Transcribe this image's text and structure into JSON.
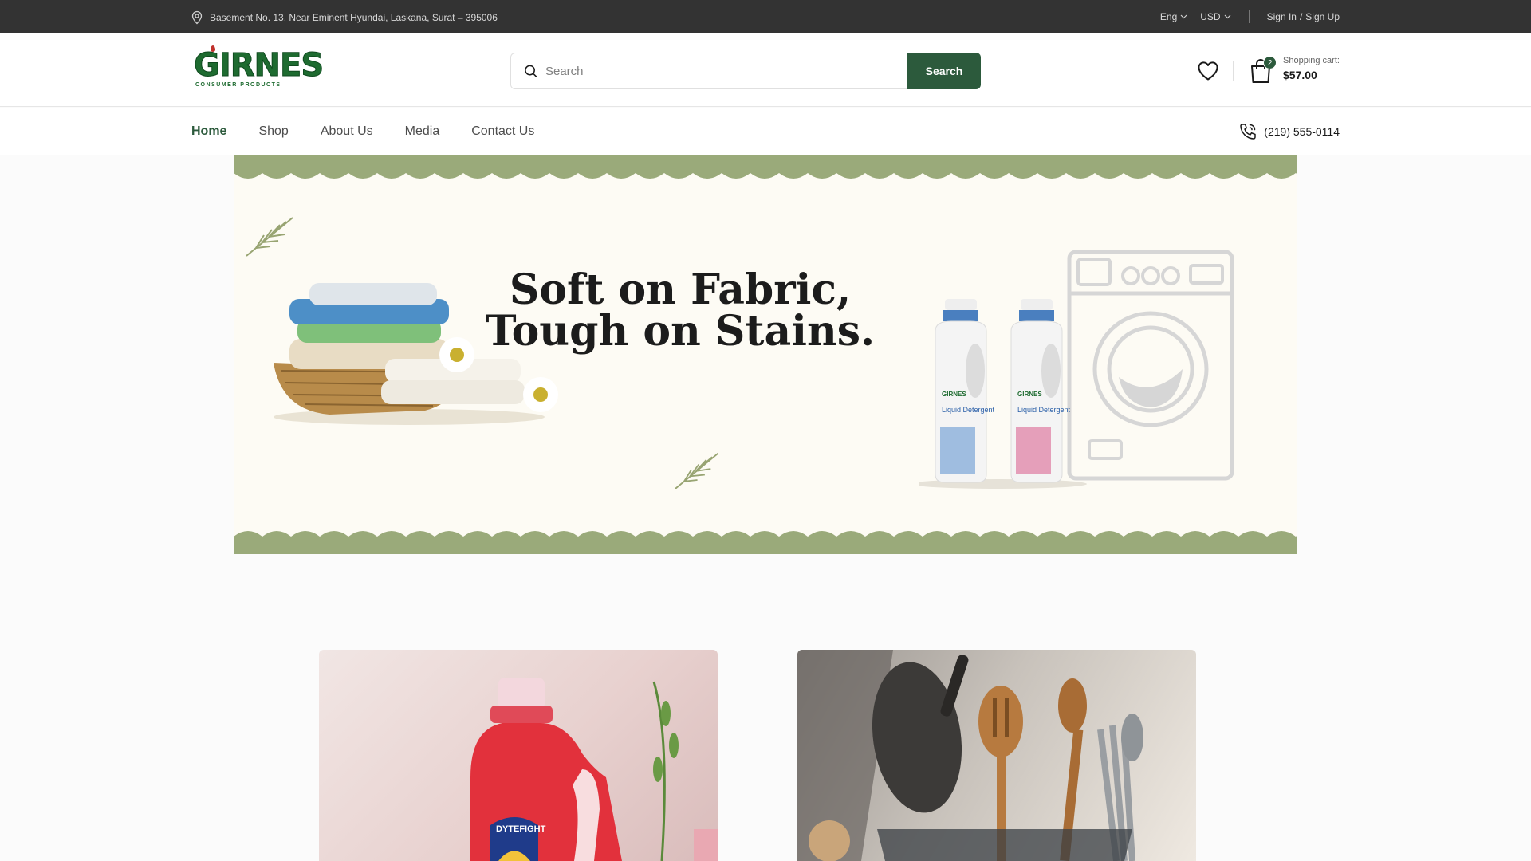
{
  "topbar": {
    "address": "Basement No. 13, Near Eminent Hyundai, Laskana, Surat – 395006",
    "language": "Eng",
    "currency": "USD",
    "sign_in": "Sign In",
    "separator": "/",
    "sign_up": "Sign Up"
  },
  "header": {
    "logo_word": "GIRNES",
    "logo_sub": "CONSUMER PRODUCTS",
    "logo_reg": "®",
    "search_placeholder": "Search",
    "search_button": "Search",
    "cart_count": "2",
    "cart_label": "Shopping cart:",
    "cart_total": "$57.00"
  },
  "nav": {
    "items": [
      "Home",
      "Shop",
      "About Us",
      "Media",
      "Contact Us"
    ],
    "active": "Home",
    "phone": "(219) 555-0114"
  },
  "banner": {
    "headline_line1": "Soft on Fabric,",
    "headline_line2": "Tough on Stains.",
    "bottle_brand": "GIRNES",
    "bottle_product": "Liquid Detergent"
  },
  "cards": {
    "card1_label": "DYTEFIGHT"
  },
  "colors": {
    "topbar_bg": "#333333",
    "brand_green": "#2c5a3c",
    "banner_wave": "#9aaa7a",
    "banner_bg": "#fdfbf4"
  }
}
